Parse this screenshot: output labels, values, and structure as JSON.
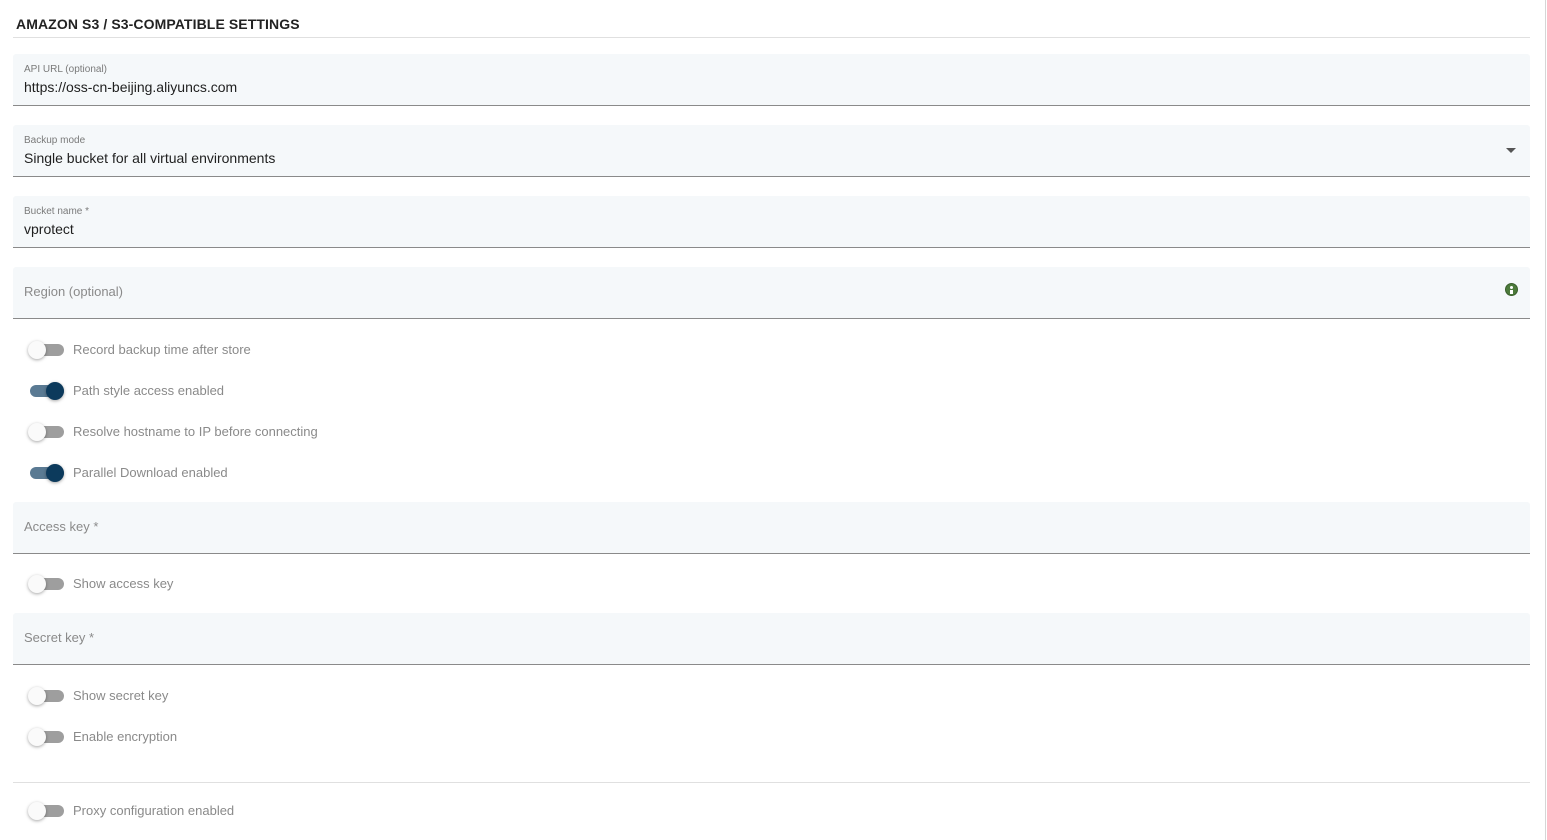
{
  "section": {
    "title": "AMAZON S3 / S3-COMPATIBLE SETTINGS"
  },
  "fields": {
    "api_url": {
      "label": "API URL (optional)",
      "value": "https://oss-cn-beijing.aliyuncs.com"
    },
    "backup_mode": {
      "label": "Backup mode",
      "value": "Single bucket for all virtual environments"
    },
    "bucket_name": {
      "label": "Bucket name *",
      "value": "vprotect"
    },
    "region": {
      "placeholder": "Region (optional)",
      "help_icon": "help-icon"
    },
    "access_key": {
      "placeholder": "Access key *"
    },
    "secret_key": {
      "placeholder": "Secret key *"
    }
  },
  "toggles": {
    "record_backup_time": {
      "label": "Record backup time after store",
      "on": false
    },
    "path_style_access": {
      "label": "Path style access enabled",
      "on": true
    },
    "resolve_hostname": {
      "label": "Resolve hostname to IP before connecting",
      "on": false
    },
    "parallel_download": {
      "label": "Parallel Download enabled",
      "on": true
    },
    "show_access_key": {
      "label": "Show access key",
      "on": false
    },
    "show_secret_key": {
      "label": "Show secret key",
      "on": false
    },
    "enable_encryption": {
      "label": "Enable encryption",
      "on": false
    },
    "proxy_configuration": {
      "label": "Proxy configuration enabled",
      "on": false
    }
  },
  "colors": {
    "toggle_on_knob": "#0c3a5c",
    "toggle_on_track": "#5a7a93",
    "toggle_off_track": "#9e9e9e",
    "field_background": "#f5f8fa",
    "help_icon": "#4c7a3a"
  }
}
